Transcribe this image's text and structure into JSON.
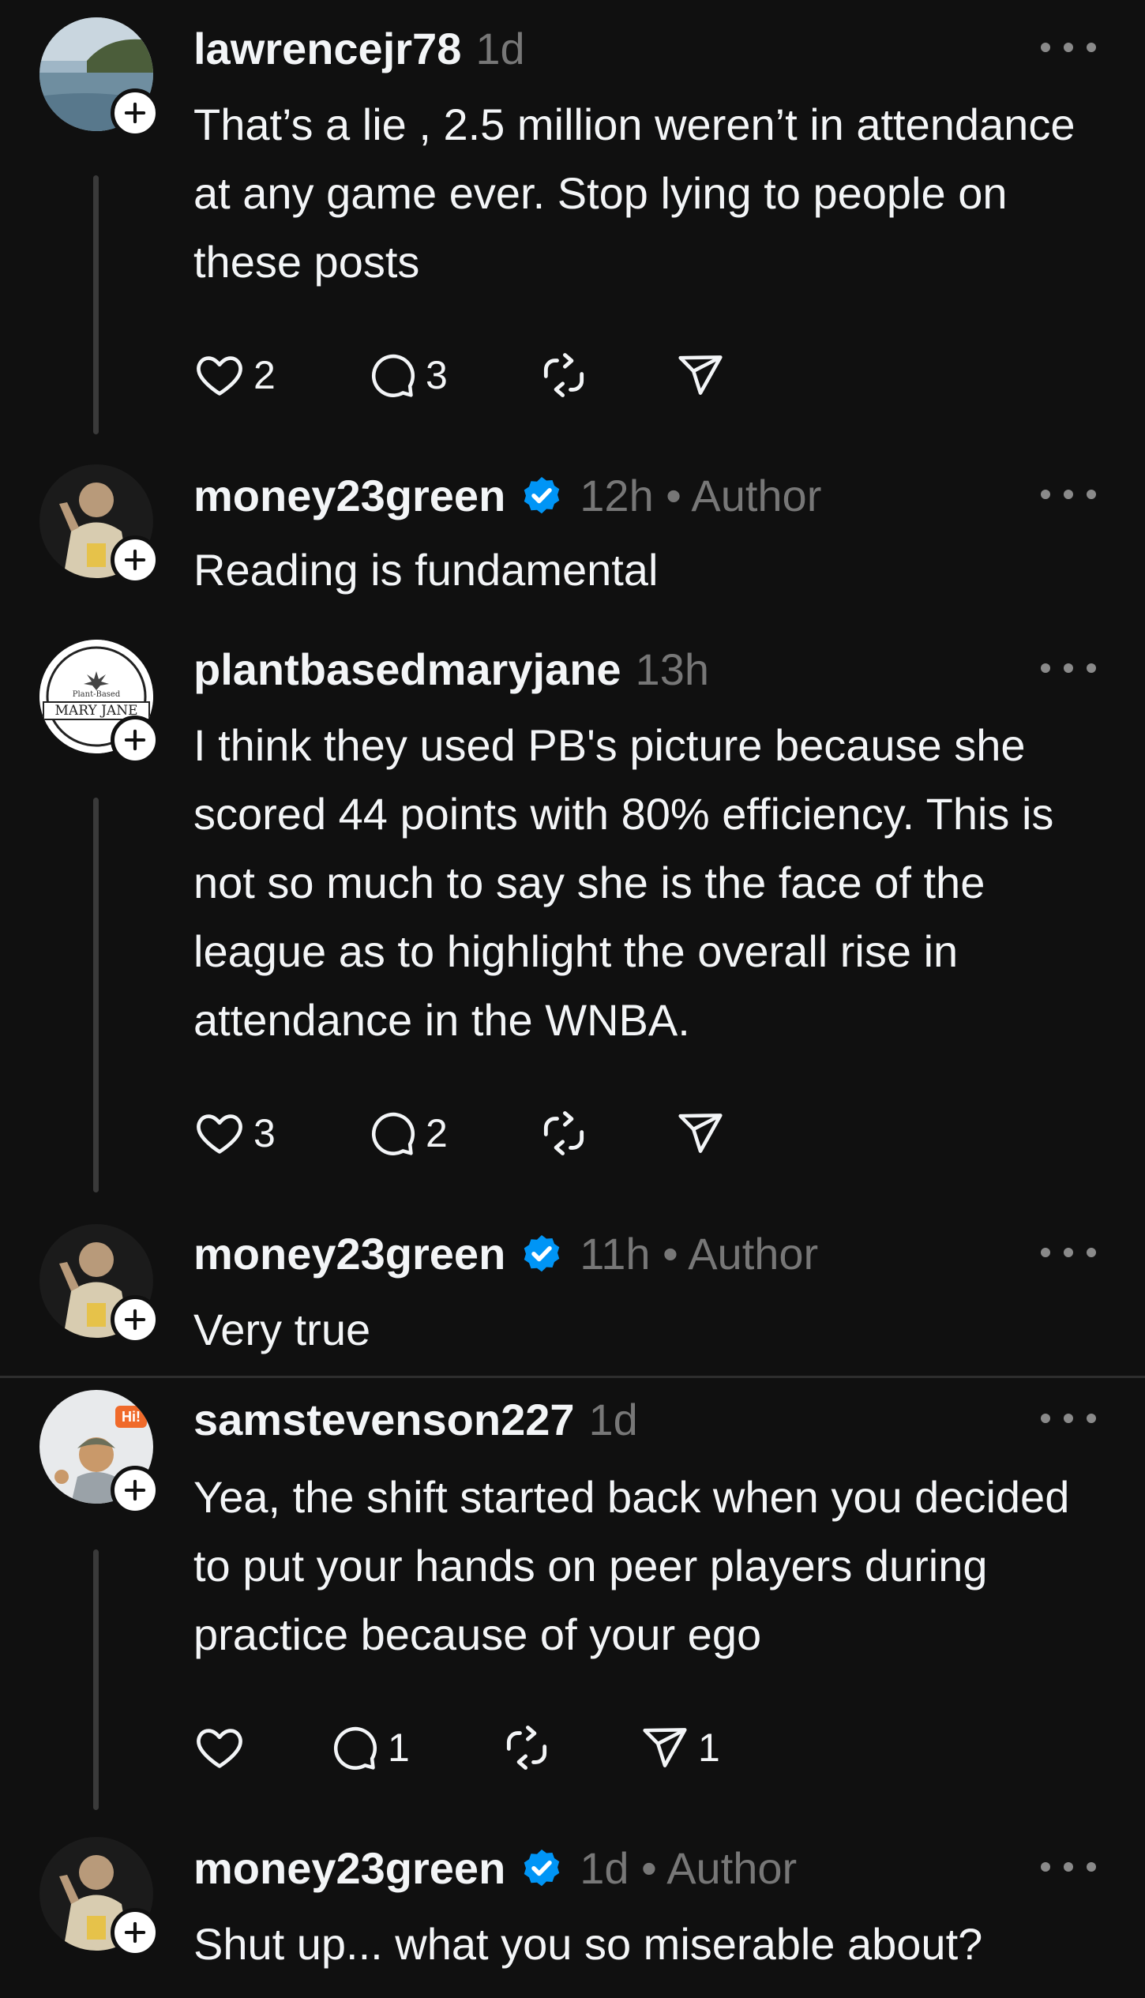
{
  "posts": [
    {
      "username": "lawrencejr78",
      "time": "1d",
      "text": "That’s a lie , 2.5 million weren’t in attendance at any game ever. Stop lying to people on these posts",
      "likes": "2",
      "replies": "3",
      "shares": ""
    },
    {
      "username": "money23green",
      "meta": "12h • Author",
      "text": "Reading is fundamental"
    },
    {
      "username": "plantbasedmaryjane",
      "time": "13h",
      "avatar_text": "MARY JANE",
      "avatar_subtext": "Plant-Based",
      "text": "I think they used PB's picture because she scored 44 points with 80% efficiency. This is not so much to say she is the face of the league as to highlight the overall rise in attendance in the WNBA.",
      "likes": "3",
      "replies": "2",
      "shares": ""
    },
    {
      "username": "money23green",
      "meta": "11h • Author",
      "text": "Very true"
    },
    {
      "username": "samstevenson227",
      "time": "1d",
      "avatar_badge": "Hi!",
      "text": "Yea, the shift started back when you decided to put your hands on peer players during practice because of your ego",
      "likes": "",
      "replies": "1",
      "shares": "1"
    },
    {
      "username": "money23green",
      "meta": "1d • Author",
      "text": "Shut up... what you so miserable about?"
    }
  ],
  "colors": {
    "background": "#101010",
    "text": "#f3f5f7",
    "muted": "#777777",
    "verified": "#0095f6",
    "thread_line": "#3a3a3a"
  },
  "icons": [
    "heart-icon",
    "comment-icon",
    "repost-icon",
    "share-icon",
    "verified-icon",
    "more-icon",
    "plus-icon"
  ]
}
